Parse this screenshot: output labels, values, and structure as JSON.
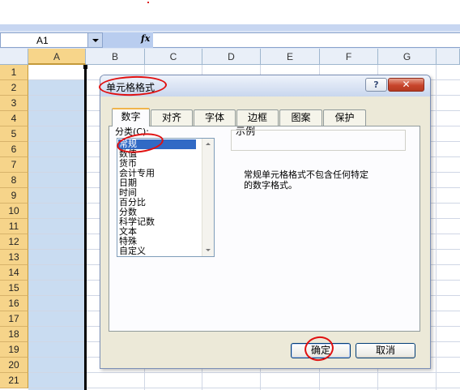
{
  "formula_bar": {
    "name_box": "A1",
    "fx_label": "fx",
    "formula": ""
  },
  "sheet": {
    "columns": [
      "A",
      "B",
      "C",
      "D",
      "E",
      "F",
      "G"
    ],
    "selected_column": "A",
    "rows": [
      "1",
      "2",
      "3",
      "4",
      "5",
      "6",
      "7",
      "8",
      "9",
      "10",
      "11",
      "12",
      "13",
      "14",
      "15",
      "16",
      "17",
      "18",
      "19",
      "20",
      "21"
    ]
  },
  "dialog": {
    "title": "单元格格式",
    "help_button": "?",
    "close_button": "✕",
    "tabs": [
      "数字",
      "对齐",
      "字体",
      "边框",
      "图案",
      "保护"
    ],
    "active_tab": "数字",
    "category_label": "分类(C):",
    "categories": [
      "常规",
      "数值",
      "货币",
      "会计专用",
      "日期",
      "时间",
      "百分比",
      "分数",
      "科学记数",
      "文本",
      "特殊",
      "自定义"
    ],
    "selected_category": "常规",
    "sample_label": "示例",
    "sample_value": "",
    "description_line1": "常规单元格格式不包含任何特定",
    "description_line2": "的数字格式。",
    "ok_button": "确定",
    "cancel_button": "取消"
  },
  "colors": {
    "selected_header": "#f7d58a",
    "selected_column_fill": "#c9dcf1",
    "annotation": "#e01010",
    "list_selection": "#316ac5"
  }
}
